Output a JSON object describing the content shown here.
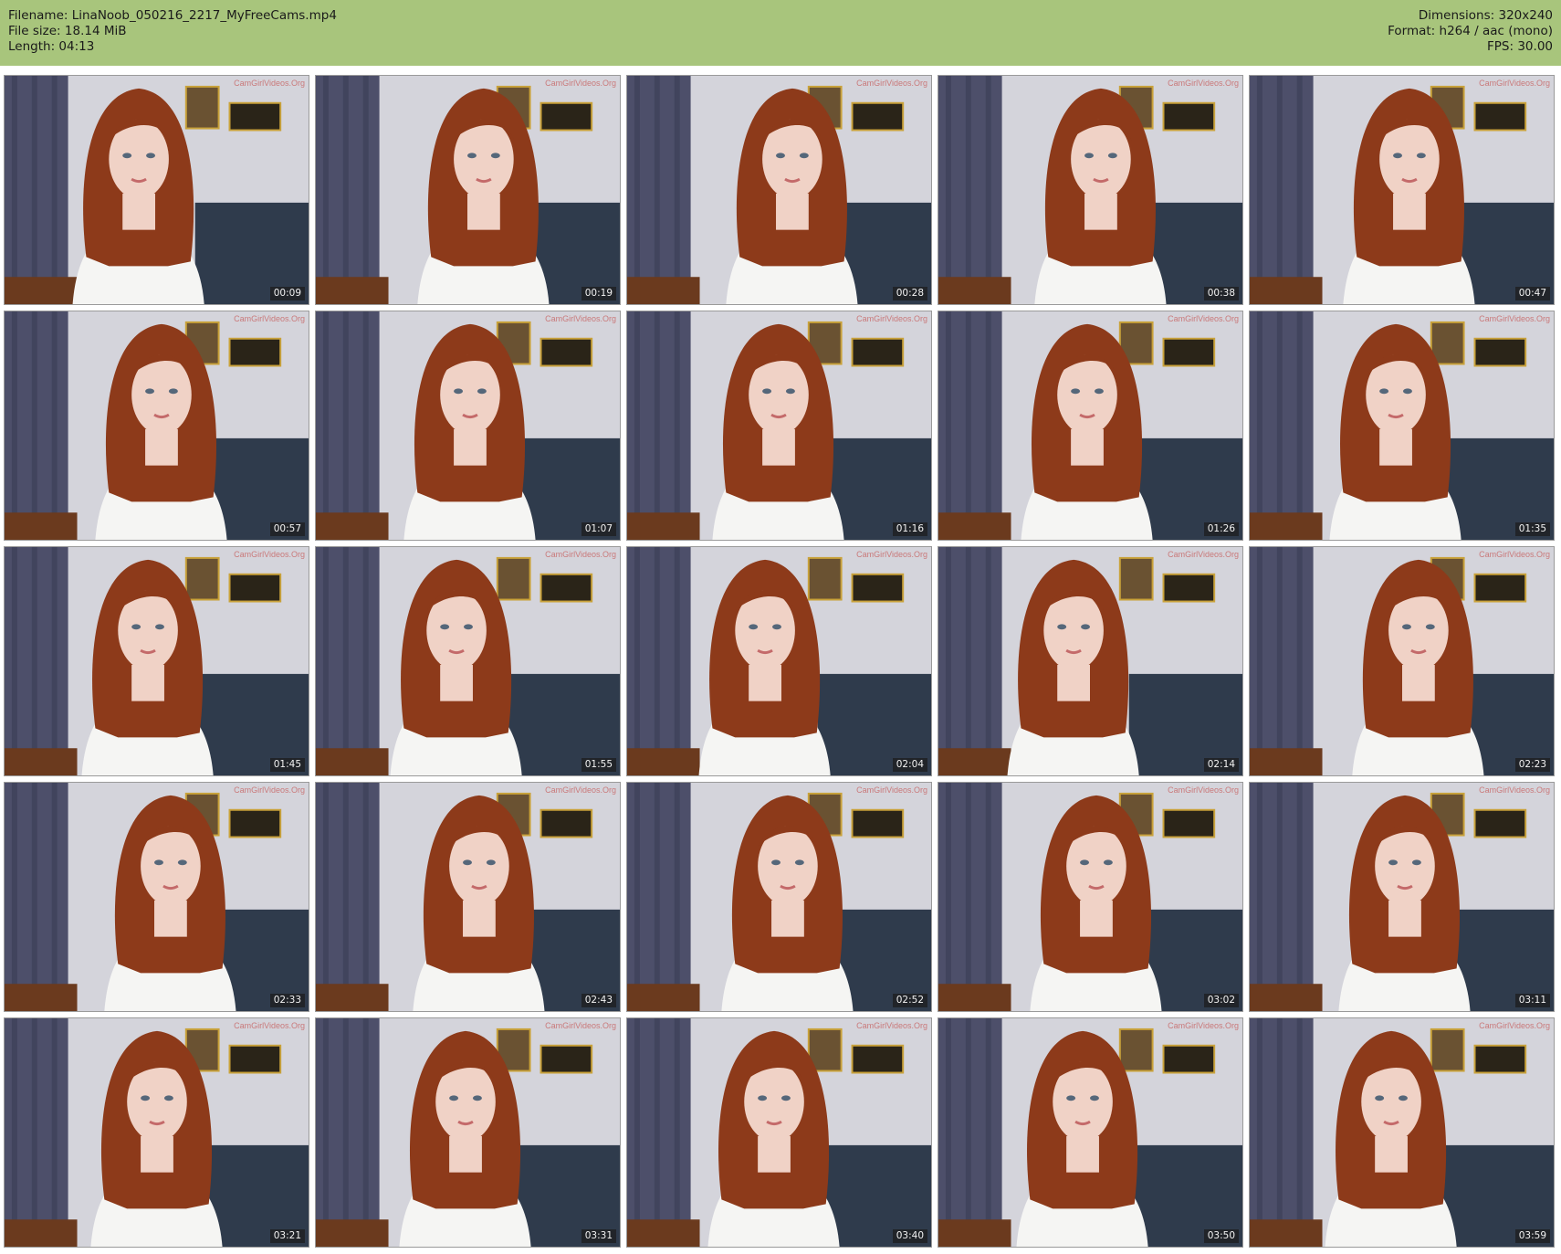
{
  "header": {
    "filename_line": "Filename: LinaNoob_050216_2217_MyFreeCams.mp4",
    "filesize_line": "File size: 18.14 MiB",
    "length_line": "Length: 04:13",
    "dimensions_line": "Dimensions: 320x240",
    "format_line": "Format: h264 / aac (mono)",
    "fps_line": "FPS: 30.00"
  },
  "watermark": "CamGirlVideos.Org",
  "colors": {
    "header_bg": "#a8c57c",
    "wall": "#d4d4db",
    "curtain": "#4d4f6a",
    "sofa": "#2f3b4c",
    "hair": "#8d3a1a",
    "skin": "#f0d2c6",
    "shirt": "#f5f5f3"
  },
  "thumbnails": [
    {
      "time": "00:09"
    },
    {
      "time": "00:19"
    },
    {
      "time": "00:28"
    },
    {
      "time": "00:38"
    },
    {
      "time": "00:47"
    },
    {
      "time": "00:57"
    },
    {
      "time": "01:07"
    },
    {
      "time": "01:16"
    },
    {
      "time": "01:26"
    },
    {
      "time": "01:35"
    },
    {
      "time": "01:45"
    },
    {
      "time": "01:55"
    },
    {
      "time": "02:04"
    },
    {
      "time": "02:14"
    },
    {
      "time": "02:23"
    },
    {
      "time": "02:33"
    },
    {
      "time": "02:43"
    },
    {
      "time": "02:52"
    },
    {
      "time": "03:02"
    },
    {
      "time": "03:11"
    },
    {
      "time": "03:21"
    },
    {
      "time": "03:31"
    },
    {
      "time": "03:40"
    },
    {
      "time": "03:50"
    },
    {
      "time": "03:59"
    }
  ]
}
